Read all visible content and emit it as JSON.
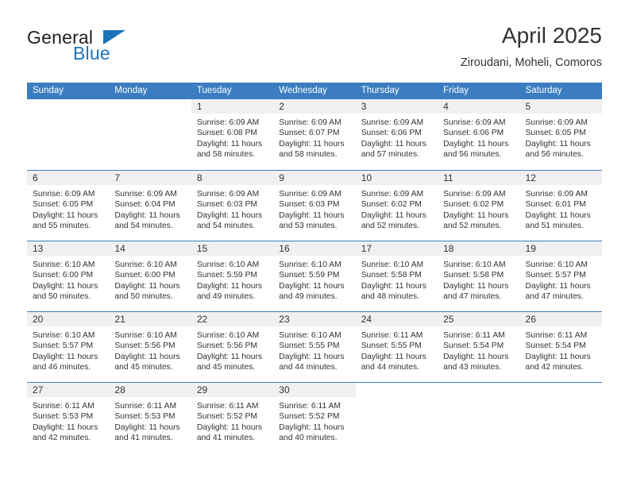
{
  "brand": {
    "word_one": "General",
    "word_two": "Blue",
    "triangle_icon": "triangle-icon",
    "color_dark": "#231f20",
    "color_blue": "#1b74bb"
  },
  "header": {
    "title": "April 2025",
    "subtitle": "Ziroudani, Moheli, Comoros"
  },
  "theme": {
    "header_blue": "#3b7dc0",
    "day_strip_gray": "#f0f0f0",
    "text": "#333333"
  },
  "calendar": {
    "weekdays": [
      "Sunday",
      "Monday",
      "Tuesday",
      "Wednesday",
      "Thursday",
      "Friday",
      "Saturday"
    ],
    "weeks": [
      [
        {
          "day": "",
          "lines": []
        },
        {
          "day": "",
          "lines": []
        },
        {
          "day": "1",
          "lines": [
            "Sunrise: 6:09 AM",
            "Sunset: 6:08 PM",
            "Daylight: 11 hours",
            "and 58 minutes."
          ]
        },
        {
          "day": "2",
          "lines": [
            "Sunrise: 6:09 AM",
            "Sunset: 6:07 PM",
            "Daylight: 11 hours",
            "and 58 minutes."
          ]
        },
        {
          "day": "3",
          "lines": [
            "Sunrise: 6:09 AM",
            "Sunset: 6:06 PM",
            "Daylight: 11 hours",
            "and 57 minutes."
          ]
        },
        {
          "day": "4",
          "lines": [
            "Sunrise: 6:09 AM",
            "Sunset: 6:06 PM",
            "Daylight: 11 hours",
            "and 56 minutes."
          ]
        },
        {
          "day": "5",
          "lines": [
            "Sunrise: 6:09 AM",
            "Sunset: 6:05 PM",
            "Daylight: 11 hours",
            "and 56 minutes."
          ]
        }
      ],
      [
        {
          "day": "6",
          "lines": [
            "Sunrise: 6:09 AM",
            "Sunset: 6:05 PM",
            "Daylight: 11 hours",
            "and 55 minutes."
          ]
        },
        {
          "day": "7",
          "lines": [
            "Sunrise: 6:09 AM",
            "Sunset: 6:04 PM",
            "Daylight: 11 hours",
            "and 54 minutes."
          ]
        },
        {
          "day": "8",
          "lines": [
            "Sunrise: 6:09 AM",
            "Sunset: 6:03 PM",
            "Daylight: 11 hours",
            "and 54 minutes."
          ]
        },
        {
          "day": "9",
          "lines": [
            "Sunrise: 6:09 AM",
            "Sunset: 6:03 PM",
            "Daylight: 11 hours",
            "and 53 minutes."
          ]
        },
        {
          "day": "10",
          "lines": [
            "Sunrise: 6:09 AM",
            "Sunset: 6:02 PM",
            "Daylight: 11 hours",
            "and 52 minutes."
          ]
        },
        {
          "day": "11",
          "lines": [
            "Sunrise: 6:09 AM",
            "Sunset: 6:02 PM",
            "Daylight: 11 hours",
            "and 52 minutes."
          ]
        },
        {
          "day": "12",
          "lines": [
            "Sunrise: 6:09 AM",
            "Sunset: 6:01 PM",
            "Daylight: 11 hours",
            "and 51 minutes."
          ]
        }
      ],
      [
        {
          "day": "13",
          "lines": [
            "Sunrise: 6:10 AM",
            "Sunset: 6:00 PM",
            "Daylight: 11 hours",
            "and 50 minutes."
          ]
        },
        {
          "day": "14",
          "lines": [
            "Sunrise: 6:10 AM",
            "Sunset: 6:00 PM",
            "Daylight: 11 hours",
            "and 50 minutes."
          ]
        },
        {
          "day": "15",
          "lines": [
            "Sunrise: 6:10 AM",
            "Sunset: 5:59 PM",
            "Daylight: 11 hours",
            "and 49 minutes."
          ]
        },
        {
          "day": "16",
          "lines": [
            "Sunrise: 6:10 AM",
            "Sunset: 5:59 PM",
            "Daylight: 11 hours",
            "and 49 minutes."
          ]
        },
        {
          "day": "17",
          "lines": [
            "Sunrise: 6:10 AM",
            "Sunset: 5:58 PM",
            "Daylight: 11 hours",
            "and 48 minutes."
          ]
        },
        {
          "day": "18",
          "lines": [
            "Sunrise: 6:10 AM",
            "Sunset: 5:58 PM",
            "Daylight: 11 hours",
            "and 47 minutes."
          ]
        },
        {
          "day": "19",
          "lines": [
            "Sunrise: 6:10 AM",
            "Sunset: 5:57 PM",
            "Daylight: 11 hours",
            "and 47 minutes."
          ]
        }
      ],
      [
        {
          "day": "20",
          "lines": [
            "Sunrise: 6:10 AM",
            "Sunset: 5:57 PM",
            "Daylight: 11 hours",
            "and 46 minutes."
          ]
        },
        {
          "day": "21",
          "lines": [
            "Sunrise: 6:10 AM",
            "Sunset: 5:56 PM",
            "Daylight: 11 hours",
            "and 45 minutes."
          ]
        },
        {
          "day": "22",
          "lines": [
            "Sunrise: 6:10 AM",
            "Sunset: 5:56 PM",
            "Daylight: 11 hours",
            "and 45 minutes."
          ]
        },
        {
          "day": "23",
          "lines": [
            "Sunrise: 6:10 AM",
            "Sunset: 5:55 PM",
            "Daylight: 11 hours",
            "and 44 minutes."
          ]
        },
        {
          "day": "24",
          "lines": [
            "Sunrise: 6:11 AM",
            "Sunset: 5:55 PM",
            "Daylight: 11 hours",
            "and 44 minutes."
          ]
        },
        {
          "day": "25",
          "lines": [
            "Sunrise: 6:11 AM",
            "Sunset: 5:54 PM",
            "Daylight: 11 hours",
            "and 43 minutes."
          ]
        },
        {
          "day": "26",
          "lines": [
            "Sunrise: 6:11 AM",
            "Sunset: 5:54 PM",
            "Daylight: 11 hours",
            "and 42 minutes."
          ]
        }
      ],
      [
        {
          "day": "27",
          "lines": [
            "Sunrise: 6:11 AM",
            "Sunset: 5:53 PM",
            "Daylight: 11 hours",
            "and 42 minutes."
          ]
        },
        {
          "day": "28",
          "lines": [
            "Sunrise: 6:11 AM",
            "Sunset: 5:53 PM",
            "Daylight: 11 hours",
            "and 41 minutes."
          ]
        },
        {
          "day": "29",
          "lines": [
            "Sunrise: 6:11 AM",
            "Sunset: 5:52 PM",
            "Daylight: 11 hours",
            "and 41 minutes."
          ]
        },
        {
          "day": "30",
          "lines": [
            "Sunrise: 6:11 AM",
            "Sunset: 5:52 PM",
            "Daylight: 11 hours",
            "and 40 minutes."
          ]
        },
        {
          "day": "",
          "lines": []
        },
        {
          "day": "",
          "lines": []
        },
        {
          "day": "",
          "lines": []
        }
      ]
    ]
  }
}
